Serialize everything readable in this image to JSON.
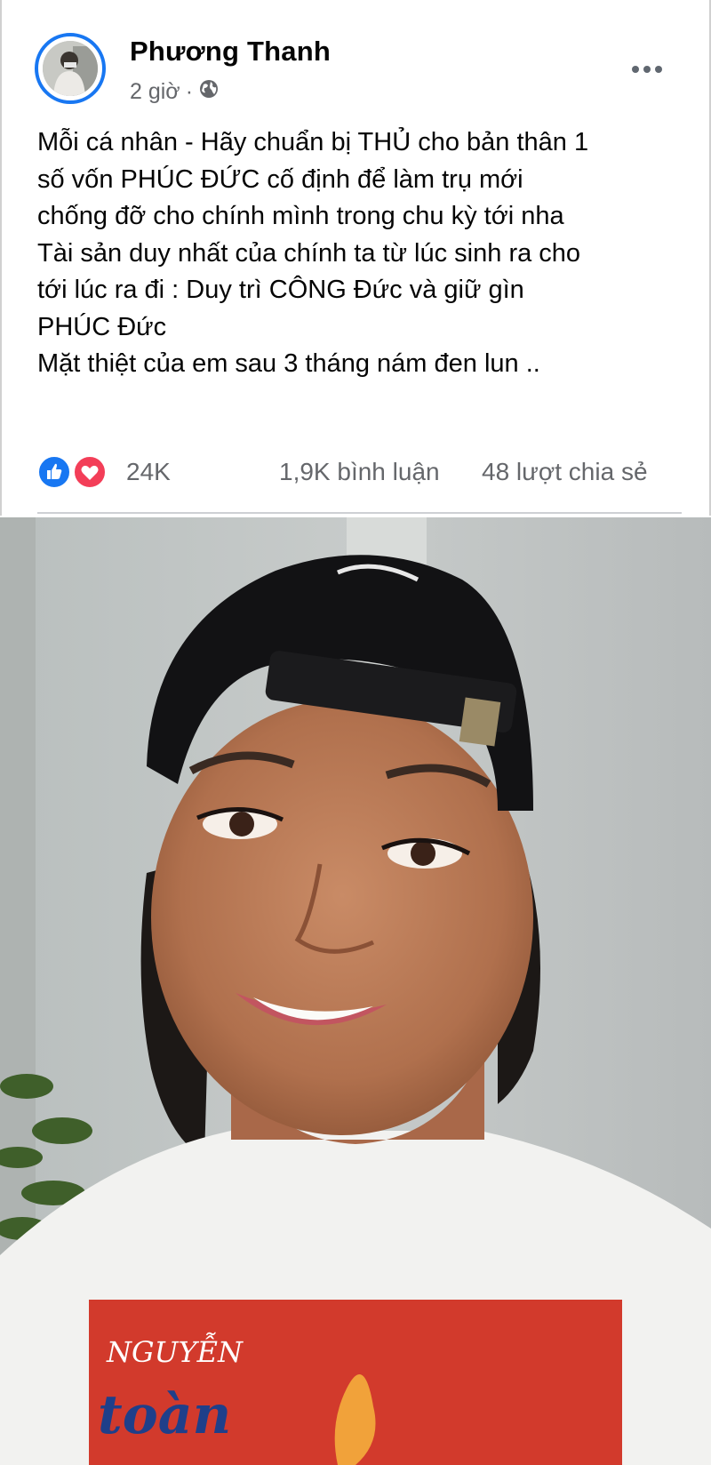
{
  "post": {
    "author": "Phương Thanh",
    "time": "2 giờ",
    "separator": "·",
    "privacy_icon": "globe-icon",
    "more_icon": "more-horizontal-icon",
    "text_lines": [
      "Mỗi cá nhân - Hãy chuẩn bị THỦ cho bản thân 1",
      "số vốn PHÚC ĐỨC cố định để làm trụ mới",
      "chống đỡ cho chính mình trong chu kỳ tới nha",
      "Tài sản duy nhất của chính ta từ lúc sinh ra cho",
      "tới lúc ra đi : Duy trì CÔNG Đức và giữ gìn",
      "PHÚC Đức",
      "Mặt thiệt của em sau 3 tháng nám đen lun .."
    ]
  },
  "engagement": {
    "reaction_icons": [
      "like-icon",
      "love-icon"
    ],
    "reactions": "24K",
    "comments": "1,9K bình luận",
    "shares": "48 lượt chia sẻ"
  },
  "colors": {
    "accent": "#1877f2",
    "love": "#f33e58",
    "secondary_text": "#65676b"
  },
  "photo": {
    "shirt_print_1": "NGUYỄN",
    "shirt_print_2": "toàn"
  }
}
